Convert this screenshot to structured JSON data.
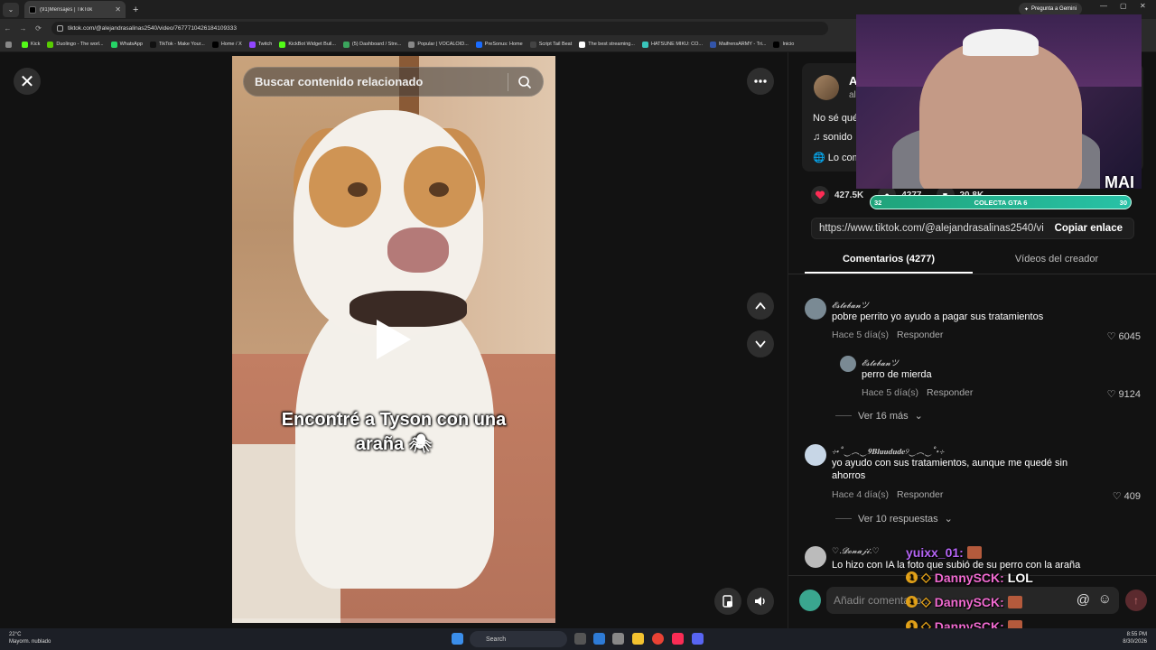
{
  "browser": {
    "tab_title": "(91)Mensajes | TikTok",
    "url": "tiktok.com/@alejandrasalinas2540/video/7677710426184109333",
    "gemini_label": "Pregunta a Gemini",
    "bookmarks": [
      {
        "label": "Kick",
        "color": "#53fc18"
      },
      {
        "label": "Duolingo - The worl...",
        "color": "#58cc02"
      },
      {
        "label": "WhatsApp",
        "color": "#25d366"
      },
      {
        "label": "TikTok - Make Your...",
        "color": "#111111"
      },
      {
        "label": "Home / X",
        "color": "#000000"
      },
      {
        "label": "Twitch",
        "color": "#9146ff"
      },
      {
        "label": "KickBot Widget Buil...",
        "color": "#53fc18"
      },
      {
        "label": "(5) Dashboard / Stre...",
        "color": "#3ba55d"
      },
      {
        "label": "Popular | VOCALOID...",
        "color": "#888888"
      },
      {
        "label": "PreSonus: Home",
        "color": "#1a6cff"
      },
      {
        "label": "Script Tail Beat",
        "color": "#444444"
      },
      {
        "label": "The best streaming...",
        "color": "#ffffff"
      },
      {
        "label": "HATSUNE MIKU: CO...",
        "color": "#39c5bb"
      },
      {
        "label": "MaifrensARMY - Tri...",
        "color": "#3355aa"
      },
      {
        "label": "Inicio",
        "color": "#000000"
      }
    ]
  },
  "video": {
    "search_placeholder": "Buscar contenido relacionado",
    "caption_line1": "Encontré a Tyson con una",
    "caption_line2": "araña 🕷"
  },
  "panel": {
    "author_initial": "A",
    "author_handle": "ale",
    "description": "No sé qué",
    "sound": "♫  sonido",
    "lo_text": "Lo com",
    "likes": "427.5K",
    "comments_count": "4277",
    "saves": "20.8K",
    "link_url": "https://www.tiktok.com/@alejandrasalinas2540/vi...",
    "copy_label": "Copiar enlace",
    "tab_comments": "Comentarios (4277)",
    "tab_videos": "Vídeos del creador",
    "comment_placeholder": "Añadir comentario..."
  },
  "comments": [
    {
      "user": "𝓔𝓼𝓽𝓮𝓫𝓪𝓷ツ",
      "text": "pobre perrito yo ayudo a pagar sus tratamientos",
      "time": "Hace 5 día(s)",
      "reply": "Responder",
      "likes": "6045"
    },
    {
      "user": "𝓔𝓼𝓽𝓮𝓫𝓪𝓷ツ",
      "text": "perro de mierda",
      "time": "Hace 5 día(s)",
      "reply": "Responder",
      "likes": "9124"
    },
    {
      "user": "⊹˖˚‿︵‿𝟗𝐁𝐥𝐮𝐮𝐝𝐮𝐝𝐞୨‿︵‿˚˖⊹",
      "text": "yo ayudo con sus tratamientos, aunque me quedé sin ahorros",
      "time": "Hace 4 día(s)",
      "reply": "Responder",
      "likes": "409"
    },
    {
      "user": "♡.𝓓𝓸𝓷𝓪𝓳𝓲.♡",
      "text": "Lo hizo con IA la foto que subió de su perro con la araña",
      "time": "",
      "reply": "",
      "likes": ""
    }
  ],
  "more_replies": [
    "Ver 16 más",
    "Ver 10 respuestas"
  ],
  "stream": {
    "cam_label": "MAI",
    "goal_left": "32",
    "goal_text": "COLECTA GTA 6",
    "goal_right": "30",
    "chat": [
      {
        "user": "yuixx_01:",
        "msg": "",
        "color": "#b565f5"
      },
      {
        "user": "DannySCK:",
        "msg": "LOL",
        "color": "#f06ad0"
      },
      {
        "user": "DannySCK:",
        "msg": "",
        "color": "#f06ad0"
      },
      {
        "user": "DannySCK:",
        "msg": "",
        "color": "#f06ad0"
      }
    ]
  },
  "taskbar": {
    "temp": "22°C",
    "weather": "Mayorm. nublado",
    "search": "Search",
    "time": "8:55 PM",
    "date": "8/30/2026"
  }
}
